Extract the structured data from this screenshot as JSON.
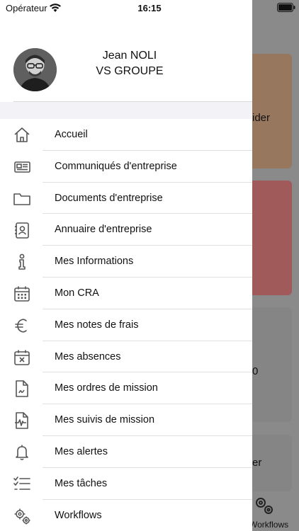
{
  "status_bar": {
    "carrier": "Opérateur",
    "time": "16:15",
    "wifi_icon": "wifi-icon",
    "battery_icon": "battery-icon"
  },
  "profile": {
    "name": "Jean NOLI",
    "company": "VS GROUPE"
  },
  "menu": {
    "items": [
      {
        "label": "Accueil",
        "icon": "home-icon"
      },
      {
        "label": "Communiqués d'entreprise",
        "icon": "newspaper-icon"
      },
      {
        "label": "Documents d'entreprise",
        "icon": "folder-icon"
      },
      {
        "label": "Annuaire d'entreprise",
        "icon": "contact-book-icon"
      },
      {
        "label": "Mes Informations",
        "icon": "info-icon"
      },
      {
        "label": "Mon CRA",
        "icon": "calendar-icon"
      },
      {
        "label": "Mes notes de frais",
        "icon": "euro-icon"
      },
      {
        "label": "Mes absences",
        "icon": "calendar-x-icon"
      },
      {
        "label": "Mes ordres de mission",
        "icon": "document-icon"
      },
      {
        "label": "Mes suivis de mission",
        "icon": "document-pulse-icon"
      },
      {
        "label": "Mes alertes",
        "icon": "bell-icon"
      },
      {
        "label": "Mes tâches",
        "icon": "checklist-icon"
      },
      {
        "label": "Workflows",
        "icon": "gears-icon"
      }
    ]
  },
  "background": {
    "card1_text": "ider",
    "card3_text": "0",
    "card4_text": "er",
    "workflows_label": "Workflows"
  }
}
